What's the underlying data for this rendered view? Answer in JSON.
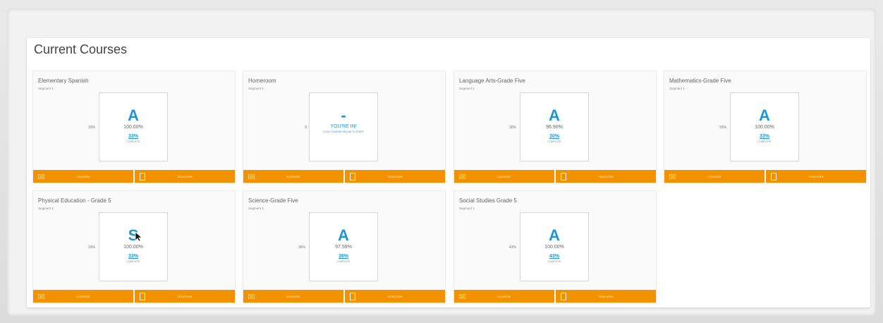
{
  "page_title": "Current Courses",
  "colors": {
    "accent": "#1b97d8",
    "button": "#f39200"
  },
  "courses": [
    {
      "title": "Elementary Spanish",
      "segment": "Segment 1",
      "side_pct": "33%",
      "grade": "A",
      "score": "100.00%",
      "complete": "33%",
      "complete_label": "COMPLETE",
      "course_label": "COURSE",
      "teacher_label": "TEACHER"
    },
    {
      "title": "Homeroom",
      "segment": "Segment 1",
      "side_pct": "0",
      "grade": "-",
      "message": "YOU'RE IN!",
      "message_sub": "CLICK COURSE BELOW TO START",
      "course_label": "COURSE",
      "teacher_label": "TEACHER"
    },
    {
      "title": "Language Arts-Grade Five",
      "segment": "Segment 1",
      "side_pct": "30%",
      "grade": "A",
      "score": "96.90%",
      "complete": "30%",
      "complete_label": "COMPLETE",
      "course_label": "COURSE",
      "teacher_label": "TEACHER"
    },
    {
      "title": "Mathematics-Grade Five",
      "segment": "Segment 1",
      "side_pct": "33%",
      "grade": "A",
      "score": "100.00%",
      "complete": "33%",
      "complete_label": "COMPLETE",
      "course_label": "COURSE",
      "teacher_label": "TEACHER"
    },
    {
      "title": "Physical Education - Grade 5",
      "segment": "Segment 1",
      "side_pct": "33%",
      "grade": "S",
      "score": "100.00%",
      "complete": "33%",
      "complete_label": "COMPLETE",
      "course_label": "COURSE",
      "teacher_label": "TEACHER"
    },
    {
      "title": "Science-Grade Five",
      "segment": "Segment 1",
      "side_pct": "36%",
      "grade": "A",
      "score": "97.59%",
      "complete": "36%",
      "complete_label": "COMPLETE",
      "course_label": "COURSE",
      "teacher_label": "TEACHER"
    },
    {
      "title": "Social Studies Grade 5",
      "segment": "Segment 1",
      "side_pct": "43%",
      "grade": "A",
      "score": "100.00%",
      "complete": "43%",
      "complete_label": "COMPLETE",
      "course_label": "COURSE",
      "teacher_label": "TEACHER"
    }
  ]
}
